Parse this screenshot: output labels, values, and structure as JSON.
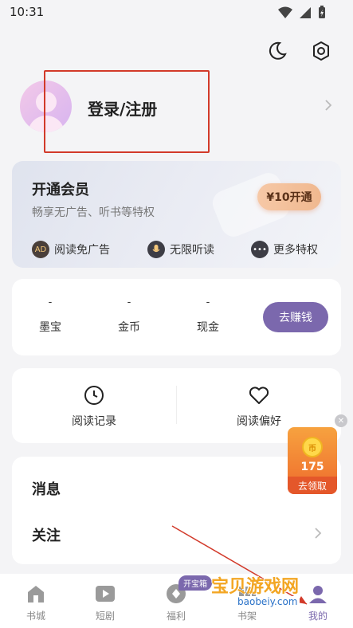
{
  "status_bar": {
    "time": "10:31"
  },
  "profile": {
    "login_label": "登录/注册"
  },
  "vip": {
    "title": "开通会员",
    "subtitle": "畅享无广告、听书等特权",
    "button": "¥10开通",
    "perks": [
      {
        "label": "阅读免广告",
        "icon": "ad-free-icon"
      },
      {
        "label": "无限听读",
        "icon": "microphone-icon"
      },
      {
        "label": "更多特权",
        "icon": "more-icon"
      }
    ]
  },
  "wallet": {
    "items": [
      {
        "value": "-",
        "label": "墨宝"
      },
      {
        "value": "-",
        "label": "金币"
      },
      {
        "value": "-",
        "label": "现金"
      }
    ],
    "earn_button": "去赚钱"
  },
  "history": {
    "items": [
      {
        "label": "阅读记录",
        "icon": "clock-icon"
      },
      {
        "label": "阅读偏好",
        "icon": "heart-icon"
      }
    ]
  },
  "menu": {
    "messages": "消息",
    "follow": "关注"
  },
  "float_widget": {
    "coin_glyph": "币",
    "count": "175",
    "button": "去领取"
  },
  "tabbar": {
    "tabs": [
      {
        "label": "书城",
        "icon": "home-icon"
      },
      {
        "label": "短剧",
        "icon": "play-icon"
      },
      {
        "label": "福利",
        "icon": "gift-icon"
      },
      {
        "label": "书架",
        "icon": "bookshelf-icon"
      },
      {
        "label": "我的",
        "icon": "profile-icon"
      }
    ],
    "badge": "开宝箱"
  },
  "watermark": {
    "title": "宝贝游戏网",
    "url": "baobeiy.com"
  },
  "colors": {
    "accent": "#7b68ad",
    "vip_button": "#f0b88f",
    "highlight": "#d23a2a",
    "widget": "#f7a23f"
  }
}
